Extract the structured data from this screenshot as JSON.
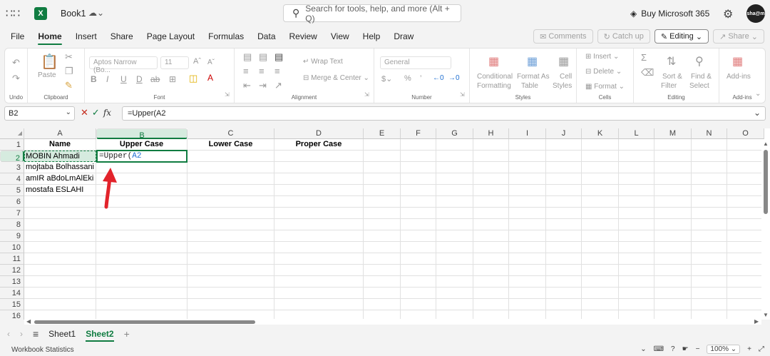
{
  "titlebar": {
    "book_name": "Book1",
    "search_placeholder": "Search for tools, help, and more (Alt + Q)",
    "buy": "Buy Microsoft 365",
    "avatar_text": "sha@m"
  },
  "tabs": [
    "File",
    "Home",
    "Insert",
    "Share",
    "Page Layout",
    "Formulas",
    "Data",
    "Review",
    "View",
    "Help",
    "Draw"
  ],
  "active_tab": "Home",
  "tab_right": {
    "comments": "Comments",
    "catchup": "Catch up",
    "editing": "Editing",
    "share": "Share"
  },
  "ribbon": {
    "undo_label": "Undo",
    "clipboard_label": "Clipboard",
    "paste": "Paste",
    "font_name": "Aptos Narrow (Bo...",
    "font_size": "11",
    "font_label": "Font",
    "wrap_text": "Wrap Text",
    "merge_center": "Merge & Center",
    "alignment_label": "Alignment",
    "number_format": "General",
    "number_label": "Number",
    "cond_fmt_1": "Conditional",
    "cond_fmt_2": "Formatting",
    "fmt_table_1": "Format As",
    "fmt_table_2": "Table",
    "cell_styles_1": "Cell",
    "cell_styles_2": "Styles",
    "styles_label": "Styles",
    "insert": "Insert",
    "delete": "Delete",
    "format": "Format",
    "cells_label": "Cells",
    "sort_1": "Sort &",
    "sort_2": "Filter",
    "find_1": "Find &",
    "find_2": "Select",
    "editing_label": "Editing",
    "addins": "Add-ins",
    "addins_label": "Add-ins"
  },
  "formula_bar": {
    "name_box": "B2",
    "formula": "=Upper(A2"
  },
  "columns": [
    "A",
    "B",
    "C",
    "D",
    "E",
    "F",
    "G",
    "H",
    "I",
    "J",
    "K",
    "L",
    "M",
    "N",
    "O"
  ],
  "rows": [
    "1",
    "2",
    "3",
    "4",
    "5",
    "6",
    "7",
    "8",
    "9",
    "10",
    "11",
    "12",
    "13",
    "14",
    "15",
    "16"
  ],
  "cells": {
    "A1": "Name",
    "B1": "Upper Case",
    "C1": "Lower Case",
    "D1": "Proper Case",
    "A2": "MOBIN Ahmadi",
    "A3": "mojtaba Bolhassani",
    "A4": "amIR aBdoLmAlEki",
    "A5": "mostafa ESLAHI",
    "B2_fn": "=Upper(",
    "B2_ref": "A2"
  },
  "sheets": [
    "Sheet1",
    "Sheet2"
  ],
  "active_sheet": "Sheet2",
  "status": {
    "left": "Workbook Statistics",
    "zoom": "100%"
  },
  "colors": {
    "accent": "#107c41",
    "ref_blue": "#1f6fd1",
    "arrow": "#e2232b"
  }
}
